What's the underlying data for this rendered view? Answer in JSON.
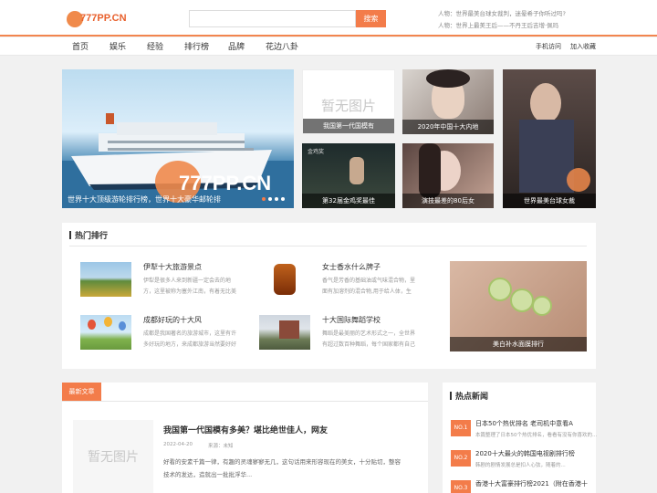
{
  "site": {
    "logo_text": "777PP.CN"
  },
  "search": {
    "placeholder": "",
    "button_label": "搜索"
  },
  "top_news": [
    "人物：世界最美台球女裁判，迷晕希子你听过吗?",
    "人物：世界上最美王后——不丹王后吉增·佩玛"
  ],
  "nav": {
    "items": [
      "首页",
      "娱乐",
      "经验",
      "排行榜",
      "品牌",
      "花边八卦"
    ],
    "right": [
      "手机访问",
      "加入收藏"
    ]
  },
  "slider": {
    "caption": "世界十大顶级游轮排行榜，世界十大豪华邮轮排",
    "watermark": "777PP.CN"
  },
  "tiles": [
    {
      "caption": "我国第一代国模有",
      "noimage": "暂无图片"
    },
    {
      "caption": "2020年中国十大内地"
    },
    {
      "caption": "世界最美台球女裁"
    },
    {
      "caption": "第32届金鸡奖最佳",
      "overlay": "金鸡奖"
    },
    {
      "caption": "演技最差的80后女"
    }
  ],
  "hot_rank": {
    "title": "热门排行",
    "items": [
      {
        "title": "伊犁十大旅游景点",
        "desc": [
          "伊犁是很多人来到新疆一定会去的地",
          "方，这里被称为塞外江南，有着无比美"
        ]
      },
      {
        "title": "女士香水什么牌子",
        "desc": [
          "香气是芳香的基础油或气味混合物，里",
          "面有加溶剂的混合物,用于给人体，生"
        ]
      },
      {
        "title": "成都好玩的十大风",
        "desc": [
          "成都是我国著名的旅游城市，这里有许",
          "多好玩的地方，来成都旅游当然要好好"
        ]
      },
      {
        "title": "十大国际舞蹈学校",
        "desc": [
          "舞蹈是最美丽的艺术形式之一，全世界",
          "有超过数百种舞蹈，每个国家都有自己"
        ]
      }
    ],
    "feature_caption": "美白补水面膜排行"
  },
  "latest": {
    "tag": "最新文章",
    "article": {
      "thumb_text": "暂无图片",
      "title": "我国第一代国模有多美？堪比绝世佳人，网友",
      "date": "2022-04-20",
      "source": "来源：未知",
      "summary": [
        "好看的安素千篇一律，有趣的灵魂寥寥无几，这句话用来形容现在的美女，十分贴切，整容",
        "技术的发达，造就出一批批浮华..."
      ]
    }
  },
  "hot_news": {
    "title": "热点新闻",
    "items": [
      {
        "badge": "NO.1",
        "title": "日本50个热优排名 老司机中意看A",
        "sub": "本篇整理了日本50个热优排名，看看有没有你喜欢的..."
      },
      {
        "badge": "NO.2",
        "title": "2020十大最火的韩国电视剧排行榜",
        "sub": "韩剧的剧情发展总是扣人心弦，随着的..."
      },
      {
        "badge": "NO.3",
        "title": "香港十大富豪排行榜2021（附在香港十",
        "sub": ""
      }
    ]
  }
}
